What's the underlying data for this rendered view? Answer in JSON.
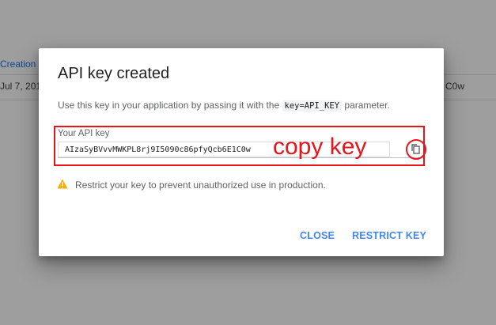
{
  "background": {
    "column_header": "Creation d",
    "row_date": "Jul 7, 201",
    "row_key_suffix": "C0w"
  },
  "dialog": {
    "title": "API key created",
    "description_before": "Use this key in your application by passing it with the",
    "description_code": "key=API_KEY",
    "description_after": "parameter.",
    "key_label": "Your API key",
    "api_key_value": "AIzaSyBVvvMWKPL8rj9I5090c86pfyQcb6E1C0w",
    "copy_icon": "copy-icon",
    "warning_icon": "warning-icon",
    "warning_text": "Restrict your key to prevent unauthorized use in production.",
    "close_label": "CLOSE",
    "restrict_label": "RESTRICT KEY"
  },
  "annotation": {
    "text": "copy key",
    "color": "#e8141a"
  },
  "colors": {
    "accent": "#4285f4",
    "warning": "#f9ab00"
  }
}
